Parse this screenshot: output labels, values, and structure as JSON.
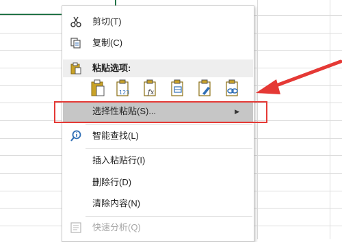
{
  "context_menu": {
    "cut": "剪切(T)",
    "copy": "复制(C)",
    "paste_options_heading": "粘贴选项:",
    "paste_special": "选择性粘贴(S)...",
    "smart_lookup": "智能查找(L)",
    "insert_paste_row": "插入粘贴行(I)",
    "delete_row": "删除行(D)",
    "clear_contents": "清除内容(N)",
    "quick_analysis": "快速分析(Q)",
    "paste_option_icons": [
      "paste-icon",
      "paste-values-icon",
      "paste-formulas-icon",
      "paste-transpose-icon",
      "paste-formatting-icon",
      "paste-link-icon"
    ],
    "submenu_arrow": "▶"
  },
  "colors": {
    "highlight": "#c6c6c6",
    "annotation_red": "#e53935",
    "selection_green": "#217346",
    "icon_gold": "#c9a227",
    "icon_blue": "#2f6eb5"
  }
}
